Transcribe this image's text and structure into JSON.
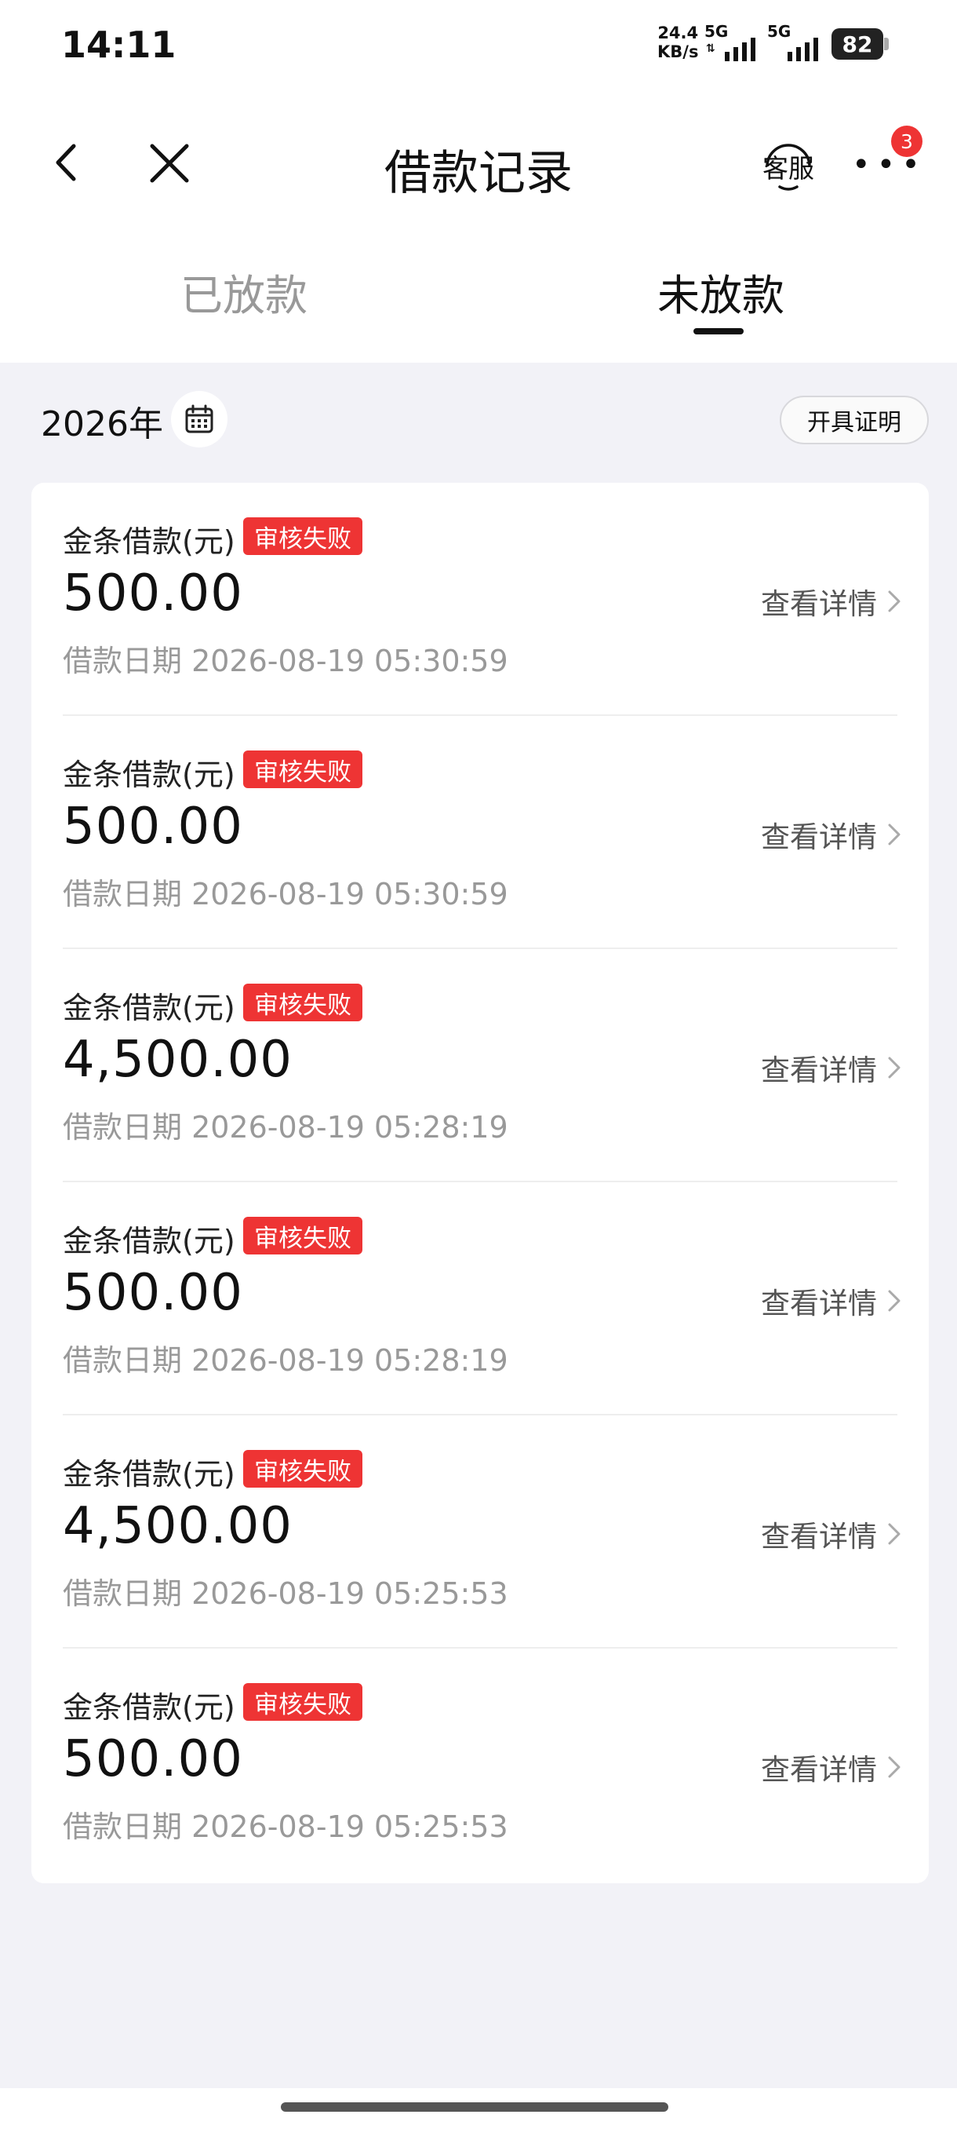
{
  "status_bar": {
    "time": "14:11",
    "speed_value": "24.4",
    "speed_unit": "KB/s",
    "net1": "5G",
    "net2": "5G",
    "battery": "82"
  },
  "nav": {
    "title": "借款记录",
    "service_label": "客服",
    "more_badge": "3"
  },
  "tabs": [
    {
      "label": "已放款",
      "active": false
    },
    {
      "label": "未放款",
      "active": true
    }
  ],
  "filter": {
    "year": "2026年",
    "certificate_label": "开具证明"
  },
  "records": [
    {
      "title": "金条借款(元)",
      "status": "审核失败",
      "amount": "500.00",
      "date": "借款日期 2026-08-19 05:30:59",
      "detail_label": "查看详情"
    },
    {
      "title": "金条借款(元)",
      "status": "审核失败",
      "amount": "500.00",
      "date": "借款日期 2026-08-19 05:30:59",
      "detail_label": "查看详情"
    },
    {
      "title": "金条借款(元)",
      "status": "审核失败",
      "amount": "4,500.00",
      "date": "借款日期 2026-08-19 05:28:19",
      "detail_label": "查看详情"
    },
    {
      "title": "金条借款(元)",
      "status": "审核失败",
      "amount": "500.00",
      "date": "借款日期 2026-08-19 05:28:19",
      "detail_label": "查看详情"
    },
    {
      "title": "金条借款(元)",
      "status": "审核失败",
      "amount": "4,500.00",
      "date": "借款日期 2026-08-19 05:25:53",
      "detail_label": "查看详情"
    },
    {
      "title": "金条借款(元)",
      "status": "审核失败",
      "amount": "500.00",
      "date": "借款日期 2026-08-19 05:25:53",
      "detail_label": "查看详情"
    }
  ],
  "colors": {
    "status_tag": "#ee3434",
    "background": "#f2f2f7",
    "card": "#ffffff"
  }
}
